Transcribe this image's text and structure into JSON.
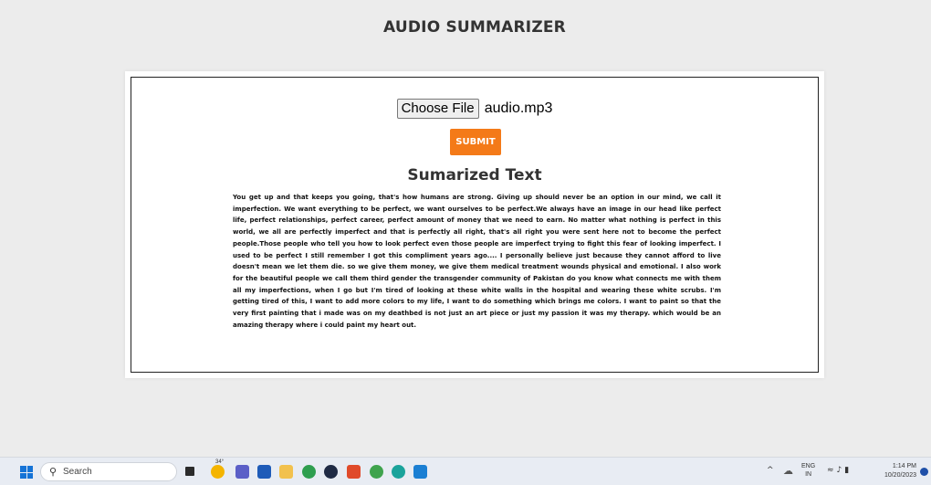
{
  "app": {
    "title": "AUDIO SUMMARIZER"
  },
  "upload": {
    "choose_file_label": "Choose File",
    "file_name": "audio.mp3",
    "submit_label": "SUBMIT"
  },
  "summary": {
    "heading": "Sumarized Text",
    "text": "You get up and that keeps you going, that's how humans are strong. Giving up should never be an option in our mind, we call it imperfection. We want everything to be perfect, we want ourselves to be perfect.We always have an image in our head like perfect life, perfect relationships, perfect career, perfect amount of money that we need to earn. No matter what nothing is perfect in this world, we all are perfectly imperfect and that is perfectly all right, that's all right you were sent here not to become the perfect people.Those people who tell you how to look perfect even those people are imperfect trying to fight this fear of looking imperfect. I used to be perfect I still remember I got this compliment years ago.... I personally believe just because they cannot afford to live doesn't mean we let them die. so we give them money, we give them medical treatment wounds physical and emotional. I also work for the beautiful people we call them third gender the transgender community of Pakistan do you know what connects me with them all my imperfections, when I go but I'm tired of looking at these white walls in the hospital and wearing these white scrubs. I'm getting tired of this, I want to add more colors to my life, I want to do something which brings me colors. I want to paint so that the very first painting that i made was on my deathbed is not just an art piece or just my passion it was my therapy. which would be an amazing therapy where i could paint my heart out."
  },
  "taskbar": {
    "search_label": "Search",
    "weather_temp": "34°",
    "icons": [
      "start-icon",
      "search-icon",
      "task-view-icon",
      "weather-icon",
      "chat-icon",
      "store-icon",
      "file-explorer-icon",
      "chrome-icon",
      "media-icon",
      "brave-icon",
      "edge-icon",
      "browser-icon",
      "vscode-icon"
    ],
    "tray": {
      "lang_top": "ENG",
      "lang_bottom": "IN",
      "time": "1:14 PM",
      "date": "10/20/2023"
    }
  },
  "colors": {
    "accent": "#f47a18",
    "page_bg": "#ececec",
    "taskbar_bg": "#e8ecf3"
  }
}
